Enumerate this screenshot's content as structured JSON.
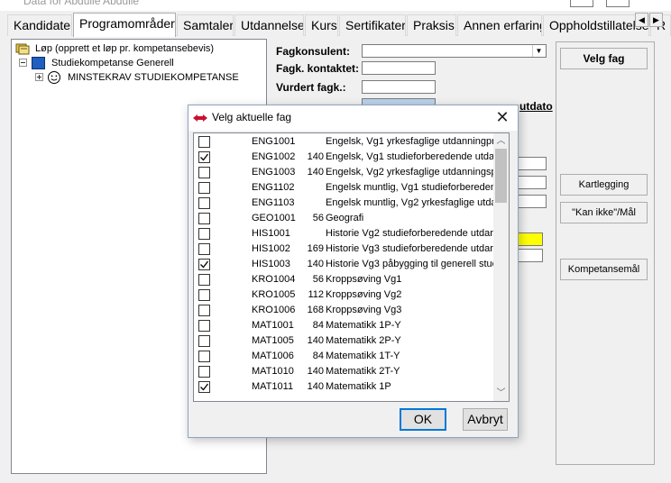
{
  "window": {
    "title": "Data for Abdulle Abdulle"
  },
  "tabs": [
    "Kandidater",
    "Programområder",
    "Samtaler",
    "Utdannelse",
    "Kurs",
    "Sertifikater",
    "Praksis",
    "Annen erfaring",
    "Oppholdstillatelse",
    "R"
  ],
  "active_tab": "Programområder",
  "tree": {
    "root": "Løp (opprett et løp pr. kompetansebevis)",
    "child": "Studiekompetanse Generell",
    "grandchild": "MINSTEKRAV STUDIEKOMPETANSE"
  },
  "form": {
    "fagkonsulent_label": "Fagkonsulent:",
    "fagk_kontaktet_label": "Fagk. kontaktet:",
    "vurdert_fagk_label": "Vurdert fagk.:",
    "offisiell_label_partial": "utdato"
  },
  "side_buttons": {
    "velg_fag": "Velg fag",
    "kartlegging": "Kartlegging",
    "kan_ikke": "\"Kan ikke\"/Mål",
    "kompetansemal": "Kompetansemål"
  },
  "dialog": {
    "title": "Velg aktuelle fag",
    "ok_label": "OK",
    "cancel_label": "Avbryt",
    "items": [
      {
        "checked": false,
        "code": "ENG1001",
        "hours": "",
        "name": "Engelsk, Vg1 yrkesfaglige utdanningpr"
      },
      {
        "checked": true,
        "code": "ENG1002",
        "hours": "140",
        "name": "Engelsk, Vg1 studieforberedende utda"
      },
      {
        "checked": false,
        "code": "ENG1003",
        "hours": "140",
        "name": "Engelsk, Vg2 yrkesfaglige utdanningsp"
      },
      {
        "checked": false,
        "code": "ENG1102",
        "hours": "",
        "name": "Engelsk muntlig, Vg1 studieforbereden"
      },
      {
        "checked": false,
        "code": "ENG1103",
        "hours": "",
        "name": "Engelsk muntlig, Vg2 yrkesfaglige utda"
      },
      {
        "checked": false,
        "code": "GEO1001",
        "hours": "56",
        "name": "Geografi"
      },
      {
        "checked": false,
        "code": "HIS1001",
        "hours": "",
        "name": "Historie Vg2 studieforberedende utdar"
      },
      {
        "checked": false,
        "code": "HIS1002",
        "hours": "169",
        "name": "Historie Vg3 studieforberedende utdar"
      },
      {
        "checked": true,
        "code": "HIS1003",
        "hours": "140",
        "name": "Historie Vg3 påbygging til generell stuc"
      },
      {
        "checked": false,
        "code": "KRO1004",
        "hours": "56",
        "name": "Kroppsøving Vg1"
      },
      {
        "checked": false,
        "code": "KRO1005",
        "hours": "112",
        "name": "Kroppsøving Vg2"
      },
      {
        "checked": false,
        "code": "KRO1006",
        "hours": "168",
        "name": "Kroppsøving Vg3"
      },
      {
        "checked": false,
        "code": "MAT1001",
        "hours": "84",
        "name": "Matematikk 1P-Y"
      },
      {
        "checked": false,
        "code": "MAT1005",
        "hours": "140",
        "name": "Matematikk 2P-Y"
      },
      {
        "checked": false,
        "code": "MAT1006",
        "hours": "84",
        "name": "Matematikk 1T-Y"
      },
      {
        "checked": false,
        "code": "MAT1010",
        "hours": "140",
        "name": "Matematikk 2T-Y"
      },
      {
        "checked": true,
        "code": "MAT1011",
        "hours": "140",
        "name": "Matematikk 1P"
      }
    ]
  },
  "colors": {
    "dialog_border": "#8fa3bf",
    "default_button_border": "#0078d7",
    "highlight_field": "#b9d1ea",
    "yellow_field": "#ffff00",
    "folder_blue": "#1f5fbf"
  }
}
